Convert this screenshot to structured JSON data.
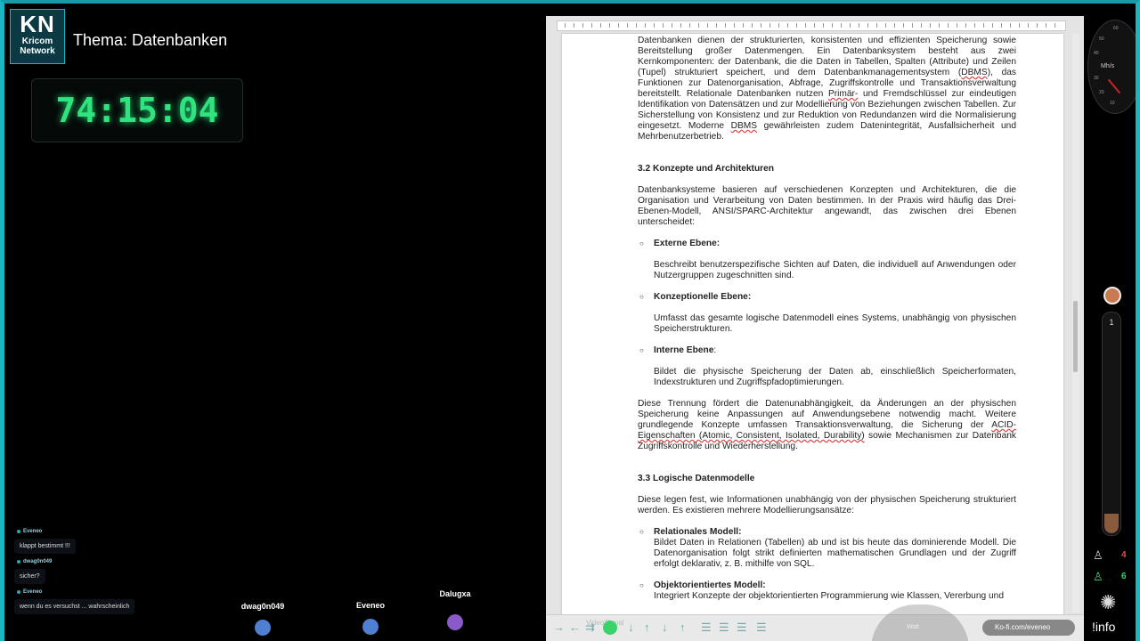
{
  "stream": {
    "logo_top": "KN",
    "logo_line1": "Kricom",
    "logo_line2": "Network",
    "theme": "Thema: Datenbanken",
    "timer": "74:15:04"
  },
  "chat": [
    {
      "user": "Eveneo",
      "text": "klappt bestimmt !!!"
    },
    {
      "user": "dwag0n049",
      "text": "sicher?"
    },
    {
      "user": "Eveneo",
      "text": "wenn du es versuchst ... wahrscheinlich"
    }
  ],
  "avatars": [
    {
      "name": "dwag0n049",
      "color": "#4f7fd0"
    },
    {
      "name": "Eveneo",
      "color": "#4f7fd0"
    },
    {
      "name": "Dalugxa",
      "color": "#8a5ac8"
    }
  ],
  "document": {
    "p_intro_a": "Datenbanken dienen der strukturierten, konsistenten und effizienten Speicherung sowie Bereitstellung großer Datenmengen. Ein Datenbanksystem besteht aus zwei Kernkomponenten: der Datenbank, die die Daten in Tabellen, Spalten (Attribute) und Zeilen (Tupel) strukturiert speichert, und dem Datenbankmanagementsystem (",
    "dbms1": "DBMS",
    "p_intro_b": "), das Funktionen zur Datenorganisation, Abfrage, Zugriffskontrolle und Transaktionsverwaltung bereitstellt. Relationale Datenbanken nutzen ",
    "primaer": "Primär-",
    "p_intro_c": " und Fremdschlüssel zur eindeutigen Identifikation von Datensätzen und zur Modellierung von Beziehungen zwischen Tabellen. Zur Sicherstellung von Konsistenz und zur Reduktion von Redundanzen wird die Normalisierung eingesetzt. Moderne ",
    "dbms2": "DBMS",
    "p_intro_d": " gewährleisten zudem Datenintegrität, Ausfallsicherheit und Mehrbenutzerbetrieb.",
    "h32": "3.2 Konzepte und Architekturen",
    "p32": "Datenbanksysteme basieren auf verschiedenen Konzepten und Architekturen, die die Organisation und Verarbeitung von Daten bestimmen. In der Praxis wird häufig das Drei-Ebenen-Modell, ANSI/SPARC-Architektur angewandt, das zwischen drei Ebenen unterscheidet:",
    "b1_title": "Externe Ebene:",
    "b1_text": "Beschreibt benutzerspezifische Sichten auf Daten, die individuell auf Anwendungen oder Nutzergruppen zugeschnitten sind.",
    "b2_title": "Konzeptionelle Ebene:",
    "b2_text": "Umfasst das gesamte logische Datenmodell eines Systems, unabhängig von physischen Speicherstrukturen.",
    "b3_title": "Interne Ebene",
    "b3_colon": ":",
    "b3_text": "Bildet die physische Speicherung der Daten ab, einschließlich Speicherformaten, Indexstrukturen und Zugriffspfadoptimierungen.",
    "p_sep_a": "Diese Trennung fördert die Datenunabhängigkeit, da Änderungen an der physischen Speicherung keine Anpassungen auf Anwendungsebene notwendig macht. Weitere grundlegende Konzepte umfassen Transaktionsverwaltung, die Sicherung der ",
    "acid": "ACID-Eigenschaften (Atomic, Consistent, Isolated, Durability)",
    "p_sep_b": " sowie Mechanismen zur Datenbank Zugriffskontrolle und Wiederherstellung.",
    "h33": "3.3 Logische Datenmodelle",
    "p33": "Diese legen fest, wie Informationen unabhängig von der physischen Speicherung strukturiert werden. Es existieren mehrere Modellierungsansätze:",
    "b4_title": "Relationales Modell:",
    "b4_text": "Bildet Daten in Relationen (Tabellen) ab und ist bis heute das dominierende Modell. Die Datenorganisation folgt strikt definierten mathematischen Grundlagen und der Zugriff erfolgt deklarativ, z. B. mithilfe von SQL.",
    "b5_title": "Objektorientiertes Modell:",
    "b5_text": "Integriert Konzepte der objektorientierten Programmierung wie Klassen, Vererbung und"
  },
  "overlay": {
    "video_label": "VideoSignal",
    "watt_label": "Watt",
    "kofi": "Ko-fi.com/eveneo"
  },
  "sidebar": {
    "speed_unit": "Mh/s",
    "speed_ticks": [
      "60",
      "50",
      "40",
      "30",
      "20",
      "10"
    ],
    "tube_value": "1",
    "viewers": "4",
    "followers": "6",
    "info": "!info",
    "viewers_color": "#e84a4a",
    "followers_color": "#3ad36b"
  }
}
